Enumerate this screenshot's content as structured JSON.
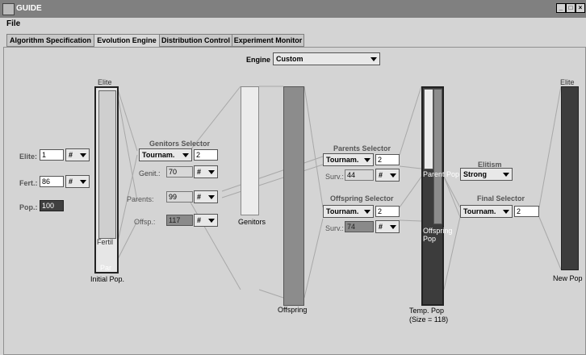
{
  "window": {
    "title": "GUIDE",
    "min": "_",
    "max": "□",
    "close": "×"
  },
  "menu": {
    "file": "File"
  },
  "tabs": [
    {
      "label": "Algorithm Specification"
    },
    {
      "label": "Evolution Engine"
    },
    {
      "label": "Distribution Control"
    },
    {
      "label": "Experiment Monitor"
    }
  ],
  "engine": {
    "label": "Engine",
    "value": "Custom"
  },
  "initial": {
    "elite_label": "Elite:",
    "elite_value": "1",
    "elite_unit": "#",
    "fert_label": "Fert.:",
    "fert_value": "86",
    "fert_unit": "#",
    "pop_label": "Pop.:",
    "pop_value": "100",
    "bar_top": "Elite",
    "bar_mid": "Fertil",
    "bar_bot": "Par",
    "caption": "Initial Pop."
  },
  "genitors_selector": {
    "title": "Genitors Selector",
    "method": "Tournam.",
    "size": "2",
    "genit_label": "Genit.:",
    "genit_value": "70",
    "genit_unit": "#",
    "parents_label": "Parents:",
    "parents_value": "99",
    "parents_unit": "#",
    "offsp_label": "Offsp.:",
    "offsp_value": "117",
    "offsp_unit": "#"
  },
  "genitors_bar": "Genitors",
  "offspring_bar": "Offspring",
  "parents_selector": {
    "title": "Parents Selector",
    "method": "Tournam.",
    "size": "2",
    "surv_label": "Surv.:",
    "surv_value": "44",
    "surv_unit": "#"
  },
  "offspring_selector": {
    "title": "Offspring Selector",
    "method": "Tournam.",
    "size": "2",
    "surv_label": "Surv.:",
    "surv_value": "74",
    "surv_unit": "#"
  },
  "temp_pop": {
    "parent_label": "Parent Pop",
    "offspring_label": "Offspring Pop",
    "caption1": "Temp. Pop",
    "caption2": "(Size = 118)"
  },
  "elitism": {
    "title": "Elitism",
    "value": "Strong"
  },
  "final_selector": {
    "title": "Final Selector",
    "method": "Tournam.",
    "size": "2"
  },
  "new_pop": {
    "bar_top": "Elite",
    "caption": "New Pop"
  }
}
